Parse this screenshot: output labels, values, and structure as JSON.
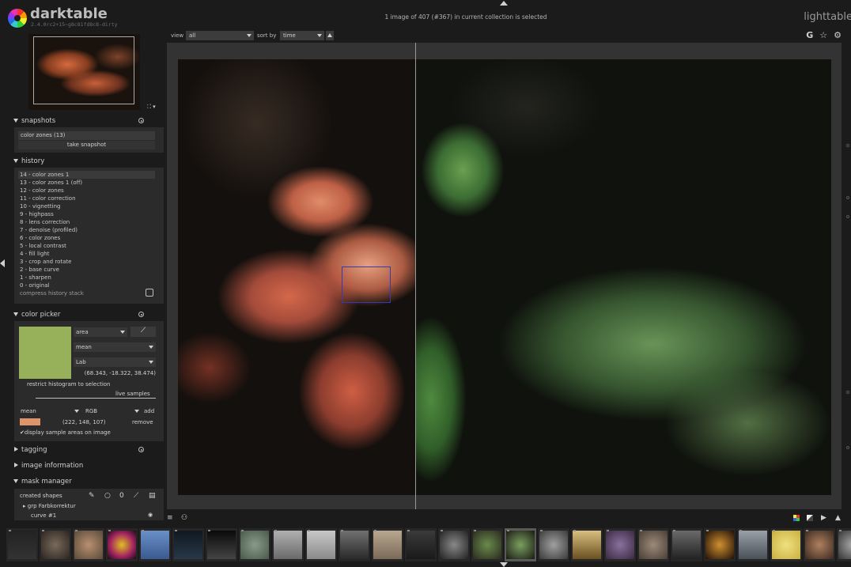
{
  "header": {
    "app_name": "darktable",
    "app_version": "2.4.0rc2+15~g8c81fd8c8-dirty",
    "status": "1 image of 407 (#367) in current collection is selected",
    "view_name": "lighttable",
    "icons": [
      "G",
      "☆",
      "⚙"
    ]
  },
  "toolbar": {
    "view_label": "view",
    "view_value": "all",
    "sort_label": "sort by",
    "sort_value": "time"
  },
  "navigation": {
    "control": "⛶ ▾"
  },
  "snapshots": {
    "title": "snapshots",
    "items": [
      "color zones (13)"
    ],
    "take_label": "take snapshot"
  },
  "history": {
    "title": "history",
    "items": [
      "14 - color zones 1",
      "13 - color zones 1 (off)",
      "12 - color zones",
      "11 - color correction",
      "10 - vignetting",
      "9 - highpass",
      "8 - lens correction",
      "7 - denoise (profiled)",
      "6 - color zones",
      "5 - local contrast",
      "4 - fill light",
      "3 - crop and rotate",
      "2 - base curve",
      "1 - sharpen",
      "0 - original"
    ],
    "compress_label": "compress history stack"
  },
  "color_picker": {
    "title": "color picker",
    "mode_value": "area",
    "stat_value": "mean",
    "space_value": "Lab",
    "swatch_color": "#97b05a",
    "values_text": "(68.343, -18.322, 38.474)",
    "restrict_label": "restrict histogram to selection",
    "live_samples_label": "live samples",
    "sample_stat": "mean",
    "sample_space": "RGB",
    "add_label": "add",
    "sample_color": "#de946b",
    "sample_values": "(222, 148, 107)",
    "remove_label": "remove",
    "display_areas_label": "display sample areas on image"
  },
  "tagging": {
    "title": "tagging"
  },
  "image_information": {
    "title": "image information"
  },
  "mask_manager": {
    "title": "mask manager",
    "created_shapes_label": "created shapes",
    "shapes_icons": [
      "✎",
      "○",
      "0",
      "⟋",
      "▤"
    ],
    "items": [
      "grp Farbkorrektur",
      "curve #1"
    ]
  },
  "colors": {
    "background": "#1b1b1b",
    "panel": "#2b2b2b",
    "accent_box": "#3a3ab0"
  },
  "filmstrip": {
    "selected_index": 15
  }
}
